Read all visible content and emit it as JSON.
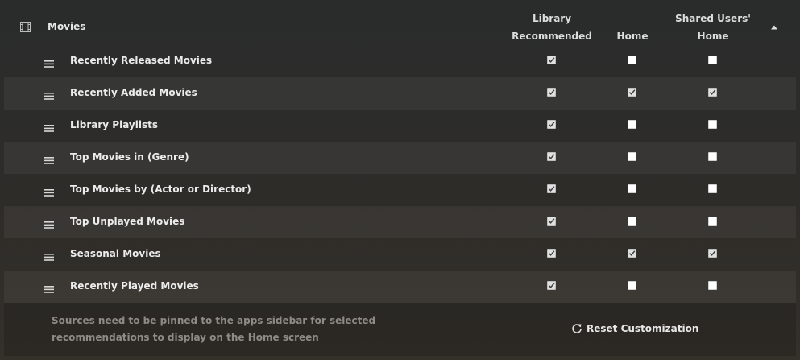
{
  "header": {
    "title": "Movies",
    "icon": "film-icon",
    "collapse_icon": "caret-up-icon"
  },
  "columns": [
    {
      "line1": "Library",
      "line2": "Recommended"
    },
    {
      "line1": "",
      "line2": "Home"
    },
    {
      "line1": "Shared Users'",
      "line2": "Home"
    }
  ],
  "rows": [
    {
      "label": "Recently Released Movies",
      "library_recommended": true,
      "home": false,
      "shared_users_home": false
    },
    {
      "label": "Recently Added Movies",
      "library_recommended": true,
      "home": true,
      "shared_users_home": true
    },
    {
      "label": "Library Playlists",
      "library_recommended": true,
      "home": false,
      "shared_users_home": false
    },
    {
      "label": "Top Movies in (Genre)",
      "library_recommended": true,
      "home": false,
      "shared_users_home": false
    },
    {
      "label": "Top Movies by (Actor or Director)",
      "library_recommended": true,
      "home": false,
      "shared_users_home": false
    },
    {
      "label": "Top Unplayed Movies",
      "library_recommended": true,
      "home": false,
      "shared_users_home": false
    },
    {
      "label": "Seasonal Movies",
      "library_recommended": true,
      "home": true,
      "shared_users_home": true
    },
    {
      "label": "Recently Played Movies",
      "library_recommended": true,
      "home": false,
      "shared_users_home": false
    }
  ],
  "footer": {
    "note": "Sources need to be pinned to the apps sidebar for selected recommendations to display on the Home screen",
    "reset_label": "Reset Customization",
    "reset_icon": "refresh-icon"
  }
}
